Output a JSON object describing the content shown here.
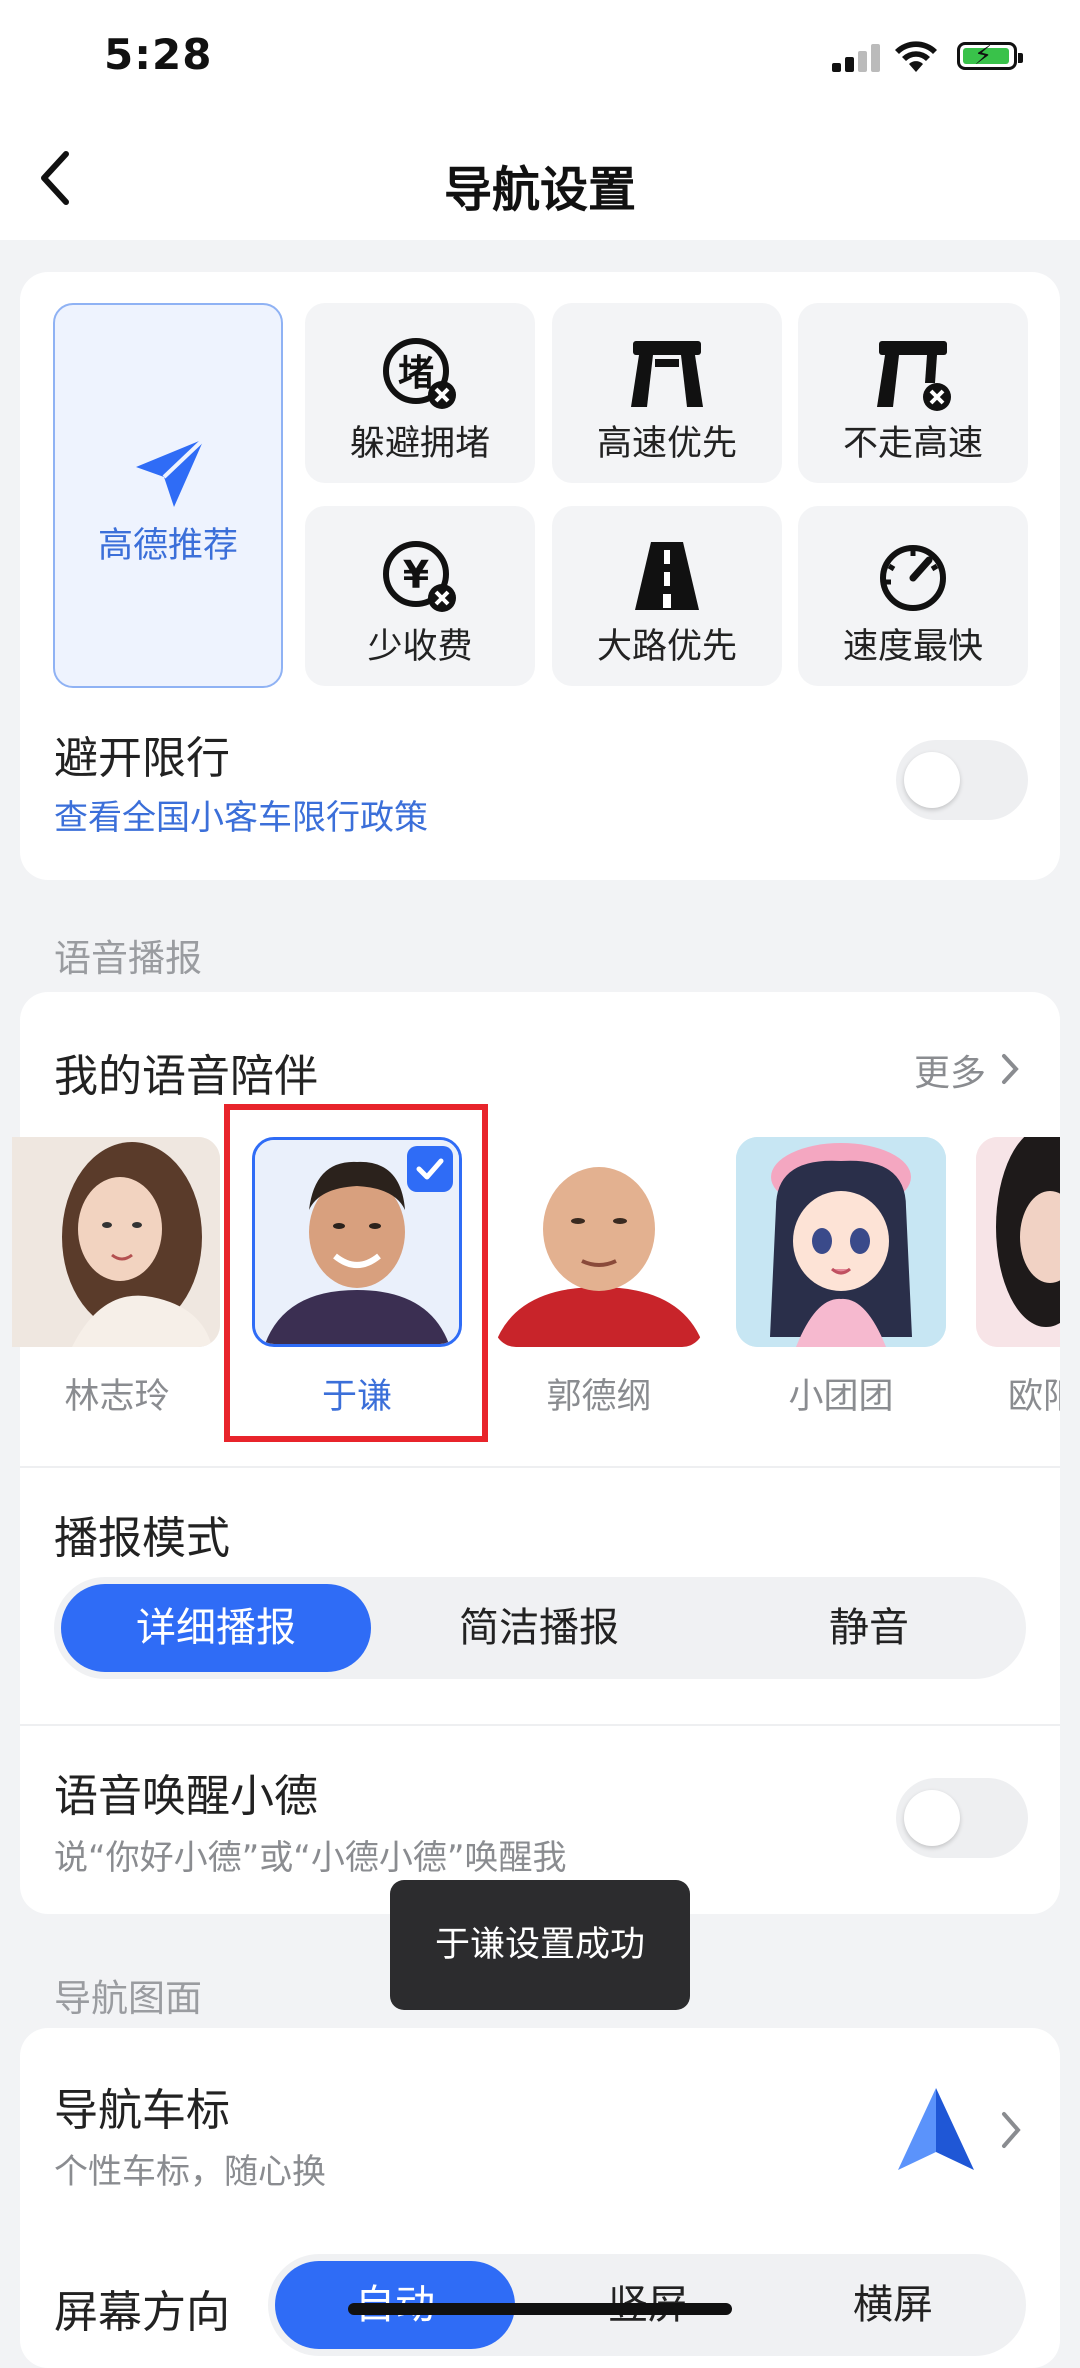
{
  "status_bar": {
    "time": "5:28"
  },
  "header": {
    "title": "导航设置"
  },
  "route_prefs": {
    "recommend": {
      "label": "高德推荐",
      "icon": "paper-plane-icon"
    },
    "options": [
      {
        "label": "躲避拥堵",
        "icon": "avoid-congestion-icon"
      },
      {
        "label": "高速优先",
        "icon": "highway-icon"
      },
      {
        "label": "不走高速",
        "icon": "no-highway-icon"
      },
      {
        "label": "少收费",
        "icon": "low-toll-icon"
      },
      {
        "label": "大路优先",
        "icon": "main-road-icon"
      },
      {
        "label": "速度最快",
        "icon": "speedometer-icon"
      }
    ]
  },
  "restriction": {
    "title": "避开限行",
    "link": "查看全国小客车限行政策",
    "enabled": false
  },
  "voice_section": {
    "label": "语音播报",
    "companion_title": "我的语音陪伴",
    "more": "更多",
    "voices": [
      {
        "name": "林志玲",
        "selected": false
      },
      {
        "name": "于谦",
        "selected": true
      },
      {
        "name": "郭德纲",
        "selected": false
      },
      {
        "name": "小团团",
        "selected": false
      },
      {
        "name": "欧阳",
        "selected": false
      }
    ],
    "mode_title": "播报模式",
    "modes": [
      "详细播报",
      "简洁播报",
      "静音"
    ],
    "mode_selected": "详细播报",
    "wake_title": "语音唤醒小德",
    "wake_sub": "说“你好小德”或“小德小德”唤醒我",
    "wake_enabled": false
  },
  "toast": {
    "text": "于谦设置成功"
  },
  "nav_view": {
    "label": "导航图面",
    "car_icon_title": "导航车标",
    "car_icon_sub": "个性车标，随心换",
    "orientation_title": "屏幕方向",
    "orientations": [
      "自动",
      "竖屏",
      "横屏"
    ],
    "orientation_selected": "自动"
  },
  "colors": {
    "accent": "#2f6cf6",
    "highlight": "#e8242b"
  }
}
